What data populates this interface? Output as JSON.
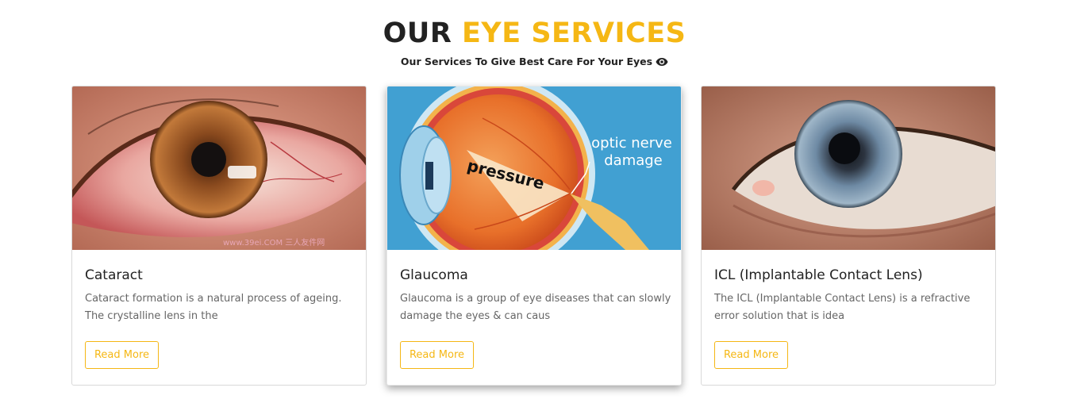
{
  "section": {
    "title_prefix": "OUR",
    "title_highlight": "EYE SERVICES",
    "subtitle": "Our Services To Give Best Care For Your Eyes"
  },
  "colors": {
    "accent": "#f5b714",
    "heading": "#222222",
    "text_muted": "#666666"
  },
  "cards": [
    {
      "title": "Cataract",
      "description": "Cataract formation is a natural process of ageing. The crystalline lens in the",
      "button": "Read More",
      "image_icon": "red-eye-photo"
    },
    {
      "title": "Glaucoma",
      "description": "Glaucoma is a group of eye diseases that can slowly damage the eyes & can caus",
      "button": "Read More",
      "image_icon": "eye-anatomy-diagram",
      "image_text": {
        "pressure": "pressure",
        "label_line1": "optic nerve",
        "label_line2": "damage"
      }
    },
    {
      "title": "ICL (Implantable Contact Lens)",
      "description": "The ICL (Implantable Contact Lens) is a refractive error solution that is idea",
      "button": "Read More",
      "image_icon": "blue-eye-photo"
    }
  ]
}
